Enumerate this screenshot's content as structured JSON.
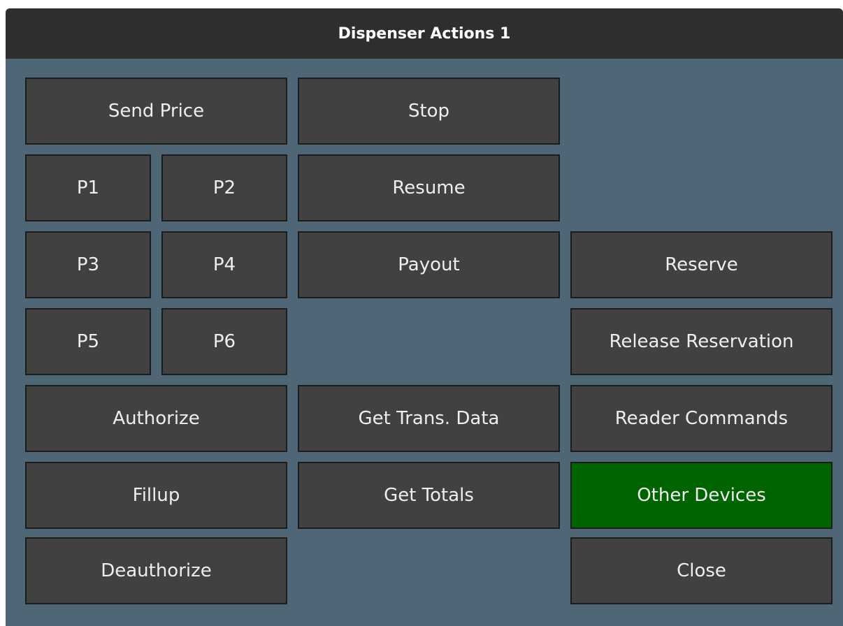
{
  "window": {
    "title": "Dispenser Actions 1"
  },
  "colors": {
    "panel_background": "#4f6677",
    "titlebar_background": "#2e2e2e",
    "button_background": "#414141",
    "button_active_background": "#006400",
    "button_text": "#eeeeee"
  },
  "buttons": {
    "send_price": "Send Price",
    "stop": "Stop",
    "p1": "P1",
    "p2": "P2",
    "resume": "Resume",
    "p3": "P3",
    "p4": "P4",
    "payout": "Payout",
    "reserve": "Reserve",
    "p5": "P5",
    "p6": "P6",
    "release_reservation": "Release Reservation",
    "authorize": "Authorize",
    "get_trans_data": "Get Trans. Data",
    "reader_commands": "Reader Commands",
    "fillup": "Fillup",
    "get_totals": "Get Totals",
    "other_devices": "Other Devices",
    "deauthorize": "Deauthorize",
    "close": "Close"
  }
}
